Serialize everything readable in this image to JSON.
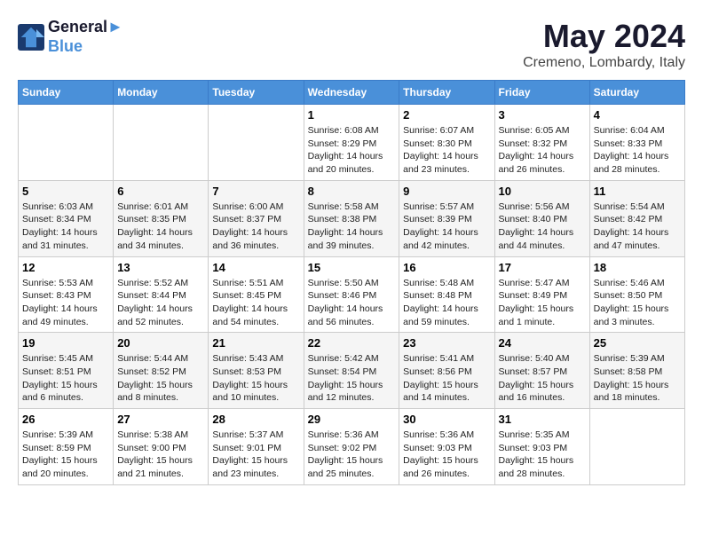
{
  "header": {
    "logo_line1": "General",
    "logo_line2": "Blue",
    "month": "May 2024",
    "location": "Cremeno, Lombardy, Italy"
  },
  "weekdays": [
    "Sunday",
    "Monday",
    "Tuesday",
    "Wednesday",
    "Thursday",
    "Friday",
    "Saturday"
  ],
  "weeks": [
    [
      {
        "day": "",
        "content": ""
      },
      {
        "day": "",
        "content": ""
      },
      {
        "day": "",
        "content": ""
      },
      {
        "day": "1",
        "content": "Sunrise: 6:08 AM\nSunset: 8:29 PM\nDaylight: 14 hours\nand 20 minutes."
      },
      {
        "day": "2",
        "content": "Sunrise: 6:07 AM\nSunset: 8:30 PM\nDaylight: 14 hours\nand 23 minutes."
      },
      {
        "day": "3",
        "content": "Sunrise: 6:05 AM\nSunset: 8:32 PM\nDaylight: 14 hours\nand 26 minutes."
      },
      {
        "day": "4",
        "content": "Sunrise: 6:04 AM\nSunset: 8:33 PM\nDaylight: 14 hours\nand 28 minutes."
      }
    ],
    [
      {
        "day": "5",
        "content": "Sunrise: 6:03 AM\nSunset: 8:34 PM\nDaylight: 14 hours\nand 31 minutes."
      },
      {
        "day": "6",
        "content": "Sunrise: 6:01 AM\nSunset: 8:35 PM\nDaylight: 14 hours\nand 34 minutes."
      },
      {
        "day": "7",
        "content": "Sunrise: 6:00 AM\nSunset: 8:37 PM\nDaylight: 14 hours\nand 36 minutes."
      },
      {
        "day": "8",
        "content": "Sunrise: 5:58 AM\nSunset: 8:38 PM\nDaylight: 14 hours\nand 39 minutes."
      },
      {
        "day": "9",
        "content": "Sunrise: 5:57 AM\nSunset: 8:39 PM\nDaylight: 14 hours\nand 42 minutes."
      },
      {
        "day": "10",
        "content": "Sunrise: 5:56 AM\nSunset: 8:40 PM\nDaylight: 14 hours\nand 44 minutes."
      },
      {
        "day": "11",
        "content": "Sunrise: 5:54 AM\nSunset: 8:42 PM\nDaylight: 14 hours\nand 47 minutes."
      }
    ],
    [
      {
        "day": "12",
        "content": "Sunrise: 5:53 AM\nSunset: 8:43 PM\nDaylight: 14 hours\nand 49 minutes."
      },
      {
        "day": "13",
        "content": "Sunrise: 5:52 AM\nSunset: 8:44 PM\nDaylight: 14 hours\nand 52 minutes."
      },
      {
        "day": "14",
        "content": "Sunrise: 5:51 AM\nSunset: 8:45 PM\nDaylight: 14 hours\nand 54 minutes."
      },
      {
        "day": "15",
        "content": "Sunrise: 5:50 AM\nSunset: 8:46 PM\nDaylight: 14 hours\nand 56 minutes."
      },
      {
        "day": "16",
        "content": "Sunrise: 5:48 AM\nSunset: 8:48 PM\nDaylight: 14 hours\nand 59 minutes."
      },
      {
        "day": "17",
        "content": "Sunrise: 5:47 AM\nSunset: 8:49 PM\nDaylight: 15 hours\nand 1 minute."
      },
      {
        "day": "18",
        "content": "Sunrise: 5:46 AM\nSunset: 8:50 PM\nDaylight: 15 hours\nand 3 minutes."
      }
    ],
    [
      {
        "day": "19",
        "content": "Sunrise: 5:45 AM\nSunset: 8:51 PM\nDaylight: 15 hours\nand 6 minutes."
      },
      {
        "day": "20",
        "content": "Sunrise: 5:44 AM\nSunset: 8:52 PM\nDaylight: 15 hours\nand 8 minutes."
      },
      {
        "day": "21",
        "content": "Sunrise: 5:43 AM\nSunset: 8:53 PM\nDaylight: 15 hours\nand 10 minutes."
      },
      {
        "day": "22",
        "content": "Sunrise: 5:42 AM\nSunset: 8:54 PM\nDaylight: 15 hours\nand 12 minutes."
      },
      {
        "day": "23",
        "content": "Sunrise: 5:41 AM\nSunset: 8:56 PM\nDaylight: 15 hours\nand 14 minutes."
      },
      {
        "day": "24",
        "content": "Sunrise: 5:40 AM\nSunset: 8:57 PM\nDaylight: 15 hours\nand 16 minutes."
      },
      {
        "day": "25",
        "content": "Sunrise: 5:39 AM\nSunset: 8:58 PM\nDaylight: 15 hours\nand 18 minutes."
      }
    ],
    [
      {
        "day": "26",
        "content": "Sunrise: 5:39 AM\nSunset: 8:59 PM\nDaylight: 15 hours\nand 20 minutes."
      },
      {
        "day": "27",
        "content": "Sunrise: 5:38 AM\nSunset: 9:00 PM\nDaylight: 15 hours\nand 21 minutes."
      },
      {
        "day": "28",
        "content": "Sunrise: 5:37 AM\nSunset: 9:01 PM\nDaylight: 15 hours\nand 23 minutes."
      },
      {
        "day": "29",
        "content": "Sunrise: 5:36 AM\nSunset: 9:02 PM\nDaylight: 15 hours\nand 25 minutes."
      },
      {
        "day": "30",
        "content": "Sunrise: 5:36 AM\nSunset: 9:03 PM\nDaylight: 15 hours\nand 26 minutes."
      },
      {
        "day": "31",
        "content": "Sunrise: 5:35 AM\nSunset: 9:03 PM\nDaylight: 15 hours\nand 28 minutes."
      },
      {
        "day": "",
        "content": ""
      }
    ]
  ]
}
